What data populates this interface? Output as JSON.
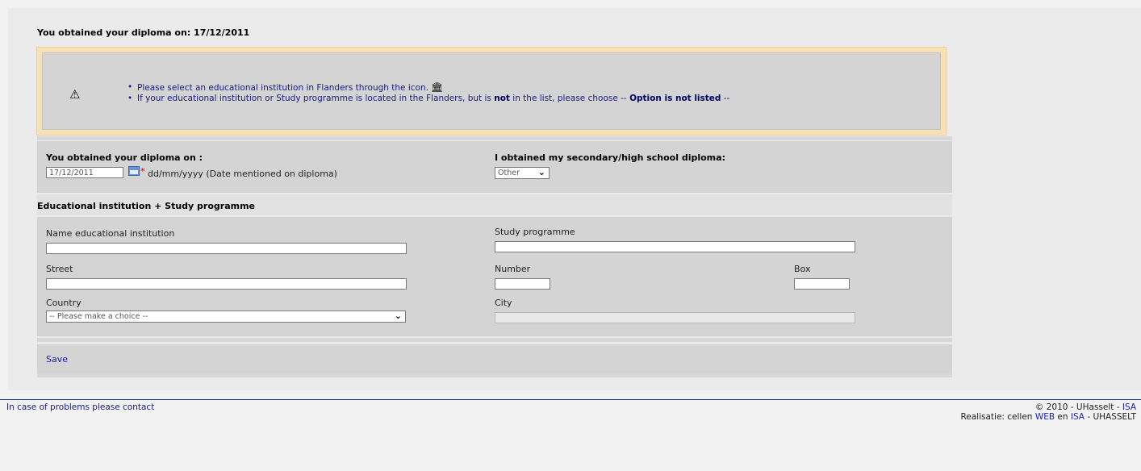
{
  "heading": "You obtained your diploma on: 17/12/2011",
  "warning": {
    "icon": "warning-triangle-icon",
    "items": {
      "0": {
        "text": "Please select an educational institution in Flanders through the icon."
      },
      "1": {
        "pre": "If your educational institution or Study programme is located in the Flanders, but is ",
        "bold": "not",
        "mid": " in the list, please choose ",
        "opt_prefix": "-- ",
        "opt_bold": "Option is not listed",
        "opt_suffix": " --"
      }
    }
  },
  "diploma": {
    "date_label": "You obtained your diploma on :",
    "date_value": "17/12/2011",
    "required_mark": "*",
    "date_hint": "dd/mm/yyyy (Date mentioned on diploma)",
    "secondary_label": "I obtained my secondary/high school diploma:",
    "secondary_value": "Other"
  },
  "institution_section": {
    "title": "Educational institution + Study programme",
    "name_label": "Name educational institution",
    "name_value": "",
    "study_label": "Study programme",
    "study_value": "",
    "street_label": "Street",
    "street_value": "",
    "number_label": "Number",
    "number_value": "",
    "box_label": "Box",
    "box_value": "",
    "country_label": "Country",
    "country_value": "-- Please make a choice --",
    "city_label": "City",
    "city_value": ""
  },
  "save_label": "Save",
  "footer": {
    "contact": "In case of problems please contact",
    "copyright": "© 2010 - UHasselt - ",
    "isa1": "ISA",
    "realisatie": "Realisatie: cellen ",
    "web": "WEB",
    "en": " en ",
    "isa2": "ISA",
    "suffix": " - UHASSELT"
  }
}
